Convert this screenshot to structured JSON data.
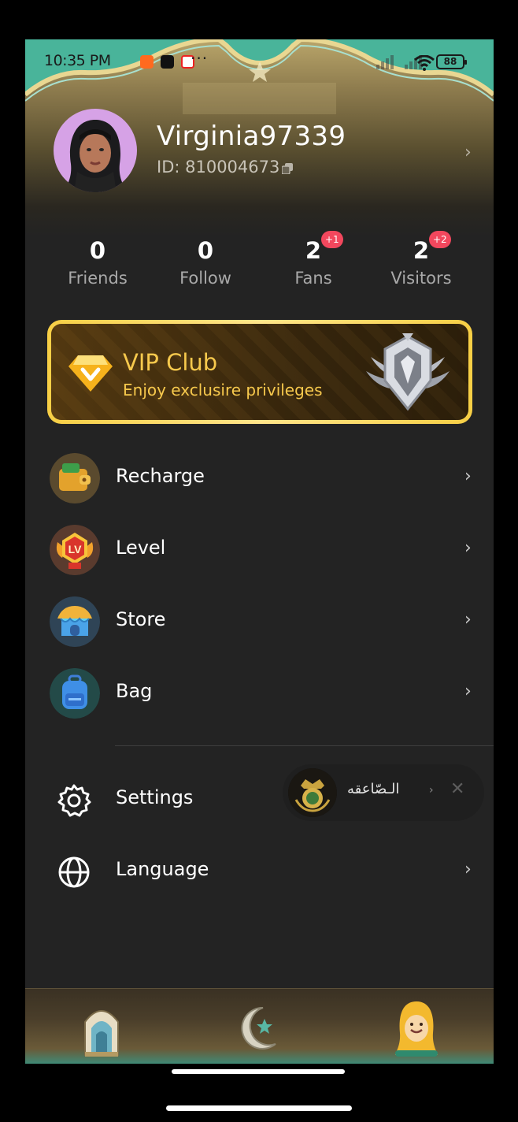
{
  "status_bar": {
    "time": "10:35 PM",
    "more": "···",
    "battery": "88"
  },
  "profile": {
    "username": "Virginia97339",
    "id_label": "ID: 810004673",
    "chevron": "›"
  },
  "stats": [
    {
      "value": "0",
      "label": "Friends",
      "badge": ""
    },
    {
      "value": "0",
      "label": "Follow",
      "badge": ""
    },
    {
      "value": "2",
      "label": "Fans",
      "badge": "+1"
    },
    {
      "value": "2",
      "label": "Visitors",
      "badge": "+2"
    }
  ],
  "vip": {
    "title": "VIP Club",
    "subtitle": "Enjoy exclusire privileges"
  },
  "menu": [
    {
      "label": "Recharge",
      "icon": "wallet-icon"
    },
    {
      "label": "Level",
      "icon": "level-badge-icon"
    },
    {
      "label": "Store",
      "icon": "store-icon"
    },
    {
      "label": "Bag",
      "icon": "backpack-icon"
    },
    {
      "label": "Settings",
      "icon": "gear-icon"
    },
    {
      "label": "Language",
      "icon": "globe-icon"
    }
  ],
  "chevron": "›",
  "floating_room": {
    "name": "الـصّاعقه",
    "arrow": "›",
    "close": "✕"
  },
  "nav": [
    {
      "icon": "mosque-icon"
    },
    {
      "icon": "crescent-star-icon"
    },
    {
      "icon": "profile-girl-icon"
    }
  ],
  "colors": {
    "accent_gold": "#f7c94d",
    "badge_red": "#f2475d",
    "background": "#232323"
  }
}
